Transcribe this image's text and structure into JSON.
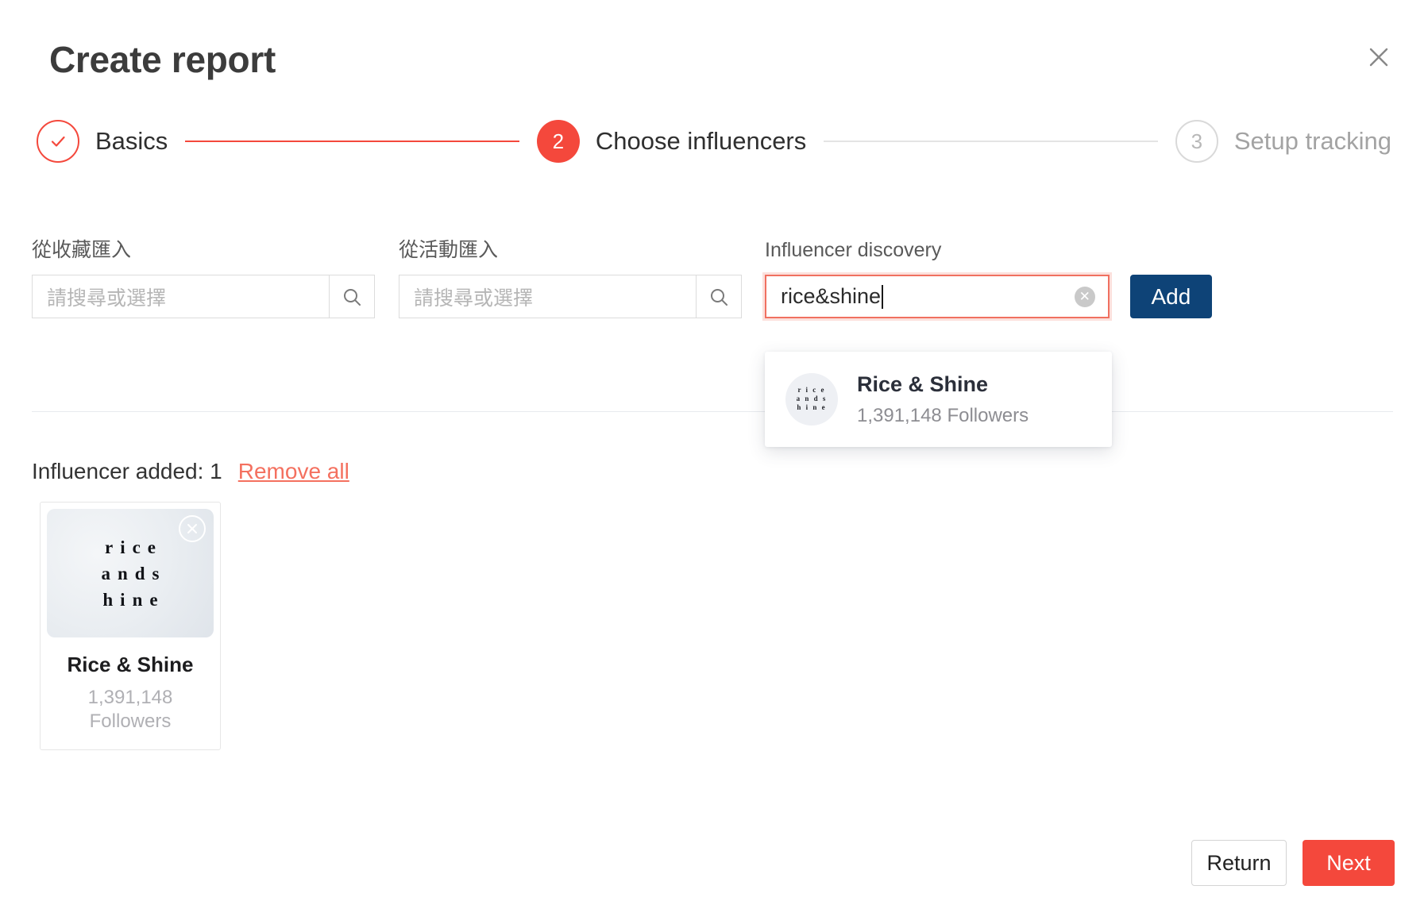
{
  "modal": {
    "title": "Create report",
    "close_icon": "close-icon"
  },
  "stepper": {
    "steps": [
      {
        "number": "1",
        "label": "Basics",
        "state": "done",
        "mark": "✓"
      },
      {
        "number": "2",
        "label": "Choose influencers",
        "state": "active"
      },
      {
        "number": "3",
        "label": "Setup tracking",
        "state": "todo"
      }
    ]
  },
  "fields": {
    "favorites": {
      "label": "從收藏匯入",
      "value": "",
      "placeholder": "請搜尋或選擇",
      "search_icon": "search-icon"
    },
    "campaign": {
      "label": "從活動匯入",
      "value": "",
      "placeholder": "請搜尋或選擇",
      "search_icon": "search-icon"
    },
    "discovery": {
      "label": "Influencer discovery",
      "value": "rice&shine",
      "clear_icon": "clear-circle-icon",
      "add_label": "Add"
    }
  },
  "dropdown": {
    "items": [
      {
        "name": "Rice & Shine",
        "followers": "1,391,148 Followers",
        "avatar_lines": [
          "r i c e",
          "a n d s",
          "h i n e"
        ]
      }
    ]
  },
  "summary": {
    "added_text": "Influencer added: 1",
    "remove_all_label": "Remove all"
  },
  "cards": [
    {
      "name": "Rice & Shine",
      "followers_count": "1,391,148",
      "followers_label": "Followers",
      "photo_lines": [
        "rice",
        "ands",
        "hine"
      ],
      "remove_icon": "remove-circle-icon"
    }
  ],
  "footer": {
    "return_label": "Return",
    "next_label": "Next"
  },
  "colors": {
    "accent_red": "#f4483c",
    "link_red": "#f4705f",
    "add_blue": "#0e4377",
    "muted_gray": "#a3a3a3"
  }
}
